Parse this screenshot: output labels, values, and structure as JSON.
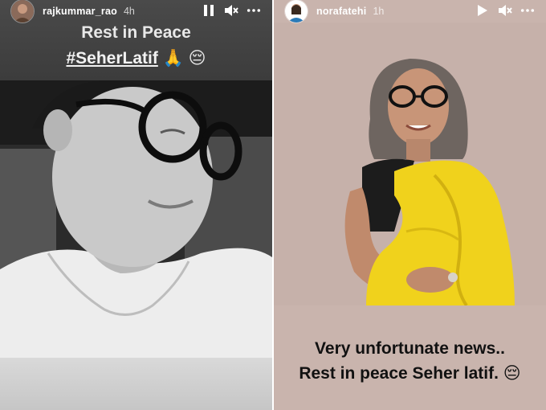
{
  "left_story": {
    "username": "rajkummar_rao",
    "timestamp": "4h",
    "caption_line1": "Rest in Peace",
    "caption_hashtag": "#SeherLatif",
    "caption_emojis": "🙏 😔",
    "controls": [
      "pause-icon",
      "muted-speaker-icon",
      "more-options-icon"
    ]
  },
  "right_story": {
    "username": "norafatehi",
    "timestamp": "1h",
    "caption_line1": "Very unfortunate news..",
    "caption_line2": "Rest in peace Seher latif.",
    "caption_emoji": "😔",
    "controls": [
      "play-icon",
      "muted-speaker-icon",
      "more-options-icon"
    ]
  },
  "colors": {
    "left_background": "#3a3a3a",
    "right_background": "#c9b4ad",
    "saree_yellow": "#f0d21c"
  }
}
